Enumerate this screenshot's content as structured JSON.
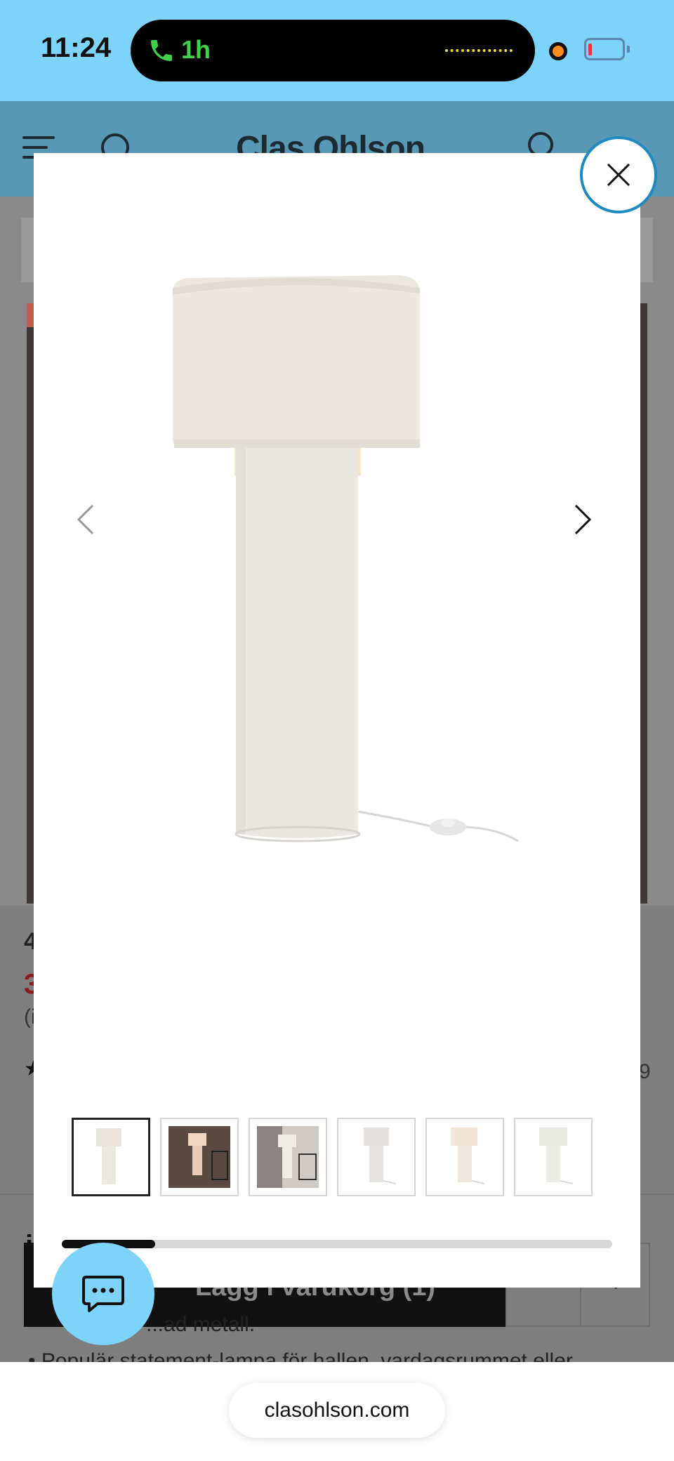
{
  "status_bar": {
    "time": "11:24",
    "call_duration": "1h",
    "battery_level": 0.1
  },
  "site_header": {
    "logo": "Clas Ohlson",
    "icons": [
      "menu-icon",
      "search-icon",
      "user-icon",
      "cart-icon"
    ]
  },
  "background_page": {
    "price_fragment": "4",
    "price_red_fragment": "3",
    "paren_fragment": "(i",
    "rating_fragment": "9",
    "i_fragment": "i",
    "add_to_cart_label": "Lägg i varukorg (1)",
    "qty_minus": "-",
    "qty_plus": "+",
    "bullet_fragment": "...ad metall.",
    "bullet_text": "Populär statement-lampa för hallen, vardagsrummet eller"
  },
  "modal": {
    "icons": {
      "close": "close-icon",
      "prev": "chevron-left-icon",
      "next": "chevron-right-icon"
    },
    "thumbnail_count": 6,
    "active_thumbnail_index": 0,
    "scroll_progress": 0.17
  },
  "browser": {
    "url": "clasohlson.com"
  },
  "chat": {
    "icon": "chat-bubble-icon"
  },
  "colors": {
    "status_bar": "#7dd4f8",
    "accent_close_border": "#1f8ac0",
    "chat_fab": "#7dd4f8",
    "sale_price_red": "#8b1b1b"
  }
}
